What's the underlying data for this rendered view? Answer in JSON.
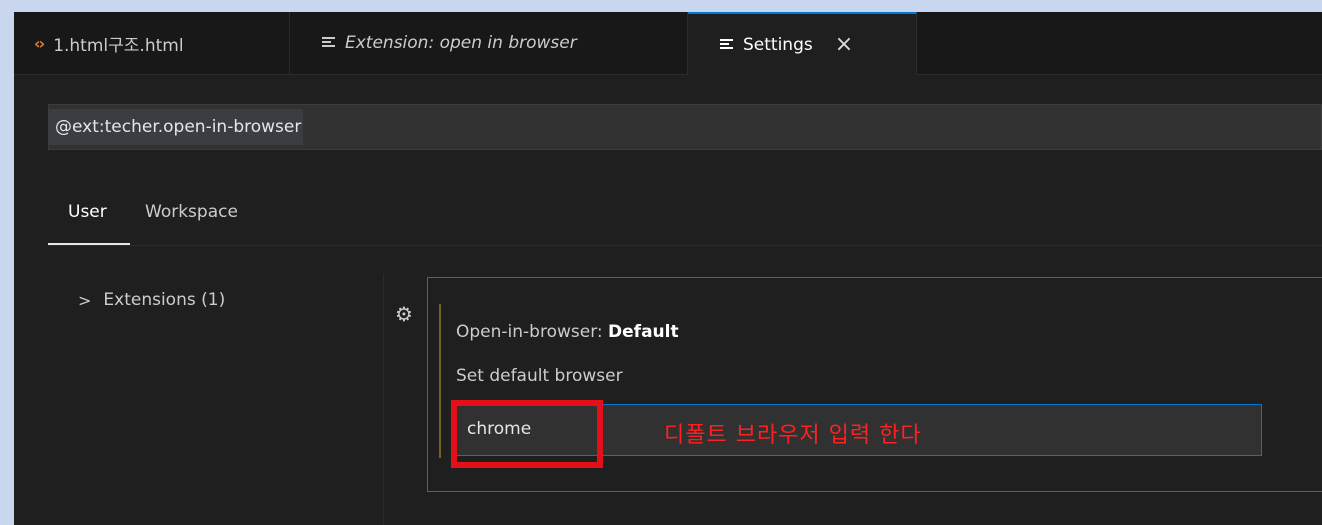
{
  "tabs": [
    {
      "label": "1.html구조.html",
      "icon": "html-file-icon"
    },
    {
      "label": "Extension: open in browser",
      "icon": "preview-lines-icon"
    },
    {
      "label": "Settings",
      "icon": "settings-lines-icon",
      "close": "×"
    }
  ],
  "search": {
    "value": "@ext:techer.open-in-browser"
  },
  "scope_tabs": {
    "user": "User",
    "workspace": "Workspace"
  },
  "tree": {
    "extensions_label": "Extensions (1)"
  },
  "setting": {
    "title_prefix": "Open-in-browser: ",
    "title_name": "Default",
    "description": "Set default browser",
    "value": "chrome"
  },
  "annotation": {
    "text": "디폴트 브라우저 입력 한다",
    "color": "#ff2020"
  },
  "colors": {
    "accent": "#0078d4",
    "highlight": "#e3101a"
  }
}
